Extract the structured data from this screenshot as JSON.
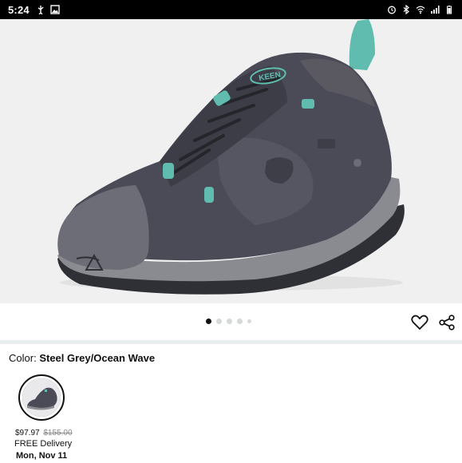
{
  "status_bar": {
    "time": "5:24",
    "left_icons": [
      "usb-icon",
      "image-icon"
    ],
    "right_icons": [
      "alarm-icon",
      "bluetooth-icon",
      "wifi-icon",
      "signal-icon",
      "battery-icon"
    ]
  },
  "gallery": {
    "image_count": 5,
    "active_index": 0
  },
  "actions": {
    "wishlist_icon": "heart-icon",
    "share_icon": "share-icon"
  },
  "product": {
    "color_label": "Color:",
    "color_value": "Steel Grey/Ocean Wave",
    "swatch": {
      "price": "$97.97",
      "list_price": "$155.00",
      "delivery": "FREE Delivery",
      "delivery_date": "Mon, Nov 11"
    },
    "shoe_logo": "KEEN"
  },
  "colors": {
    "shoe_body": "#4a4b57",
    "shoe_sole": "#8a8b91",
    "accent": "#5fbcae",
    "image_bg": "#f0f0f0"
  }
}
